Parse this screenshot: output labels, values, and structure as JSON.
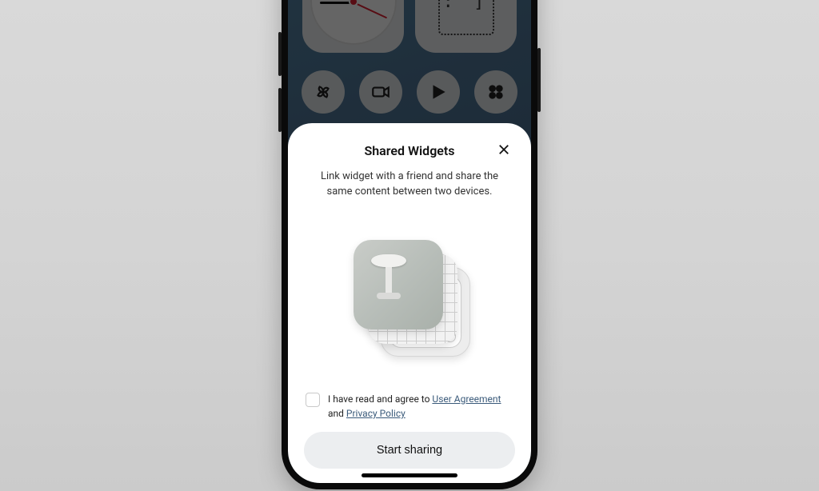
{
  "modal": {
    "title": "Shared Widgets",
    "description": "Link widget with a friend and share the same content between two devices.",
    "agree_prefix": "I have read and agree to ",
    "link_user_agreement": "User Agreement",
    "agree_and": " and ",
    "link_privacy_policy": "Privacy Policy",
    "primary_button": "Start sharing"
  },
  "icons": {
    "close": "close",
    "home_apps": [
      "pinwheel",
      "camera",
      "play",
      "clover"
    ]
  }
}
